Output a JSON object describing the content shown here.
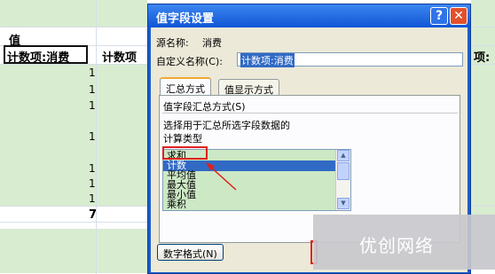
{
  "sheet": {
    "header_label": "值",
    "col1_header": "计数项:消费",
    "col2_header": "计数项",
    "right_header_fragment": "项:",
    "values": [
      "1",
      "1",
      "1",
      "1",
      "1",
      "1",
      "1"
    ],
    "total": "7"
  },
  "dialog": {
    "title": "值字段设置",
    "help_button": "?",
    "close_button": "✕",
    "source_name_label": "源名称:",
    "source_name_value": "消费",
    "custom_name_label": "自定义名称(C):",
    "custom_name_value": "计数项:消费",
    "tabs": [
      "汇总方式",
      "值显示方式"
    ],
    "group_label": "值字段汇总方式(S)",
    "description_line1": "选择用于汇总所选字段数据的",
    "description_line2": "计算类型",
    "list_items": [
      "求和",
      "计数",
      "平均值",
      "最大值",
      "最小值",
      "乘积"
    ],
    "selected_item": "计数",
    "number_format_button": "数字格式(N)"
  },
  "watermark": "优创网络",
  "colors": {
    "title_bar": "#0f55d6",
    "selection": "#316ac5",
    "highlight_box": "#e02020",
    "list_bg": "#cde8c5"
  }
}
